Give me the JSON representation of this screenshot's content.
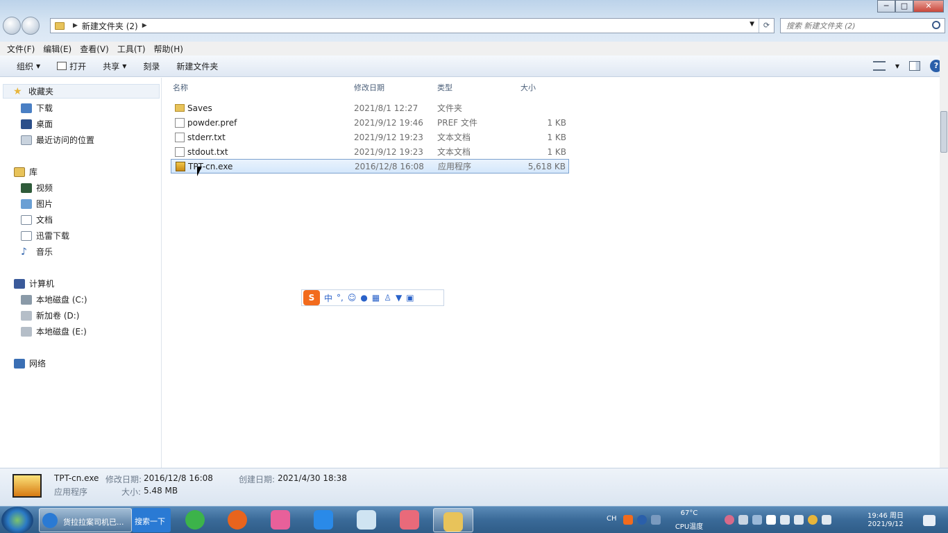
{
  "window": {
    "address": {
      "crumb": "新建文件夹 (2)"
    },
    "search": {
      "placeholder": "搜索 新建文件夹 (2)"
    },
    "controls": {
      "minimize": "─",
      "maximize": "□",
      "close": "✕"
    }
  },
  "menubar": {
    "items": [
      "文件(F)",
      "编辑(E)",
      "查看(V)",
      "工具(T)",
      "帮助(H)"
    ]
  },
  "toolbar": {
    "organize": "组织",
    "open": "打开",
    "share": "共享",
    "burn": "刻录",
    "new_folder": "新建文件夹"
  },
  "sidebar": {
    "favorites": "收藏夹",
    "downloads": "下载",
    "desktop": "桌面",
    "recent": "最近访问的位置",
    "libraries": "库",
    "videos": "视频",
    "pictures": "图片",
    "documents": "文档",
    "thunder": "迅雷下载",
    "music": "音乐",
    "computer": "计算机",
    "disk_c": "本地磁盘 (C:)",
    "disk_d": "新加卷 (D:)",
    "disk_e": "本地磁盘 (E:)",
    "network": "网络"
  },
  "columns": {
    "name": "名称",
    "date": "修改日期",
    "type": "类型",
    "size": "大小"
  },
  "files": [
    {
      "name": "Saves",
      "date": "2021/8/1 12:27",
      "type": "文件夹",
      "size": "",
      "icon": "folder-icon"
    },
    {
      "name": "powder.pref",
      "date": "2021/9/12 19:46",
      "type": "PREF 文件",
      "size": "1 KB",
      "icon": "file-icon"
    },
    {
      "name": "stderr.txt",
      "date": "2021/9/12 19:23",
      "type": "文本文档",
      "size": "1 KB",
      "icon": "text-file-icon"
    },
    {
      "name": "stdout.txt",
      "date": "2021/9/12 19:23",
      "type": "文本文档",
      "size": "1 KB",
      "icon": "text-file-icon"
    },
    {
      "name": "TPT-cn.exe",
      "date": "2016/12/8 16:08",
      "type": "应用程序",
      "size": "5,618 KB",
      "icon": "exe-icon",
      "selected": true
    }
  ],
  "ime": {
    "mode": "中",
    "punct": "°,"
  },
  "details": {
    "filename": "TPT-cn.exe",
    "filetype": "应用程序",
    "modified_label": "修改日期:",
    "modified": "2016/12/8 16:08",
    "created_label": "创建日期:",
    "created": "2021/4/30 18:38",
    "size_label": "大小:",
    "size": "5.48 MB"
  },
  "taskbar": {
    "task1": "货拉拉案司机已...",
    "search": "搜索一下",
    "temp": "67°C",
    "cpu": "CPU温度",
    "lang": "CH",
    "time": "19:46 周日",
    "date": "2021/9/12"
  },
  "colors": {
    "selection": "#d4e7fb",
    "accent": "#2a5faa"
  }
}
